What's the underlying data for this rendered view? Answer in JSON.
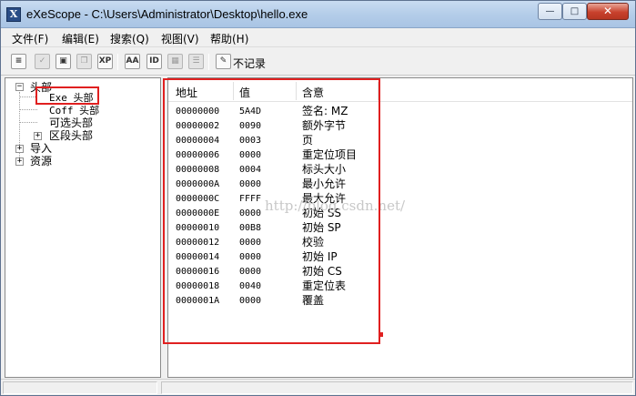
{
  "window": {
    "title": "eXeScope - C:\\Users\\Administrator\\Desktop\\hello.exe",
    "app_icon_text": "X",
    "buttons": {
      "minimize": "—",
      "maximize": "□",
      "close": "✕"
    }
  },
  "menu": [
    "文件(F)",
    "编辑(E)",
    "搜索(Q)",
    "视图(V)",
    "帮助(H)"
  ],
  "toolbar": {
    "icons": [
      {
        "name": "new-file-icon",
        "glyph": "≡",
        "disabled": false
      },
      {
        "name": "check-icon",
        "glyph": "✓",
        "disabled": true
      },
      {
        "name": "save-icon",
        "glyph": "▣",
        "disabled": false
      },
      {
        "name": "copy-icon",
        "glyph": "❐",
        "disabled": true
      },
      {
        "name": "xp-icon",
        "glyph": "XP",
        "disabled": false
      },
      {
        "name": "font-icon",
        "glyph": "AA",
        "disabled": false
      },
      {
        "name": "dialog-icon",
        "glyph": "ID",
        "disabled": false
      },
      {
        "name": "image-icon",
        "glyph": "▦",
        "disabled": true
      },
      {
        "name": "menu-icon",
        "glyph": "☰",
        "disabled": true
      },
      {
        "name": "record-icon",
        "glyph": "✎",
        "disabled": false
      }
    ],
    "record_label": "不记录"
  },
  "tree": {
    "root": "头部",
    "children": [
      "Exe 头部",
      "Coff 头部",
      "可选头部",
      "区段头部"
    ],
    "siblings": [
      "导入",
      "资源"
    ],
    "expander_open": "−",
    "expander_closed": "+"
  },
  "list": {
    "columns": [
      "地址",
      "值",
      "含意"
    ],
    "rows": [
      {
        "addr": "00000000",
        "val": "5A4D",
        "meaning": "签名: MZ"
      },
      {
        "addr": "00000002",
        "val": "0090",
        "meaning": "额外字节"
      },
      {
        "addr": "00000004",
        "val": "0003",
        "meaning": "页"
      },
      {
        "addr": "00000006",
        "val": "0000",
        "meaning": "重定位项目"
      },
      {
        "addr": "00000008",
        "val": "0004",
        "meaning": "标头大小"
      },
      {
        "addr": "0000000A",
        "val": "0000",
        "meaning": "最小允许"
      },
      {
        "addr": "0000000C",
        "val": "FFFF",
        "meaning": "最大允许"
      },
      {
        "addr": "0000000E",
        "val": "0000",
        "meaning": "初始 SS"
      },
      {
        "addr": "00000010",
        "val": "00B8",
        "meaning": "初始 SP"
      },
      {
        "addr": "00000012",
        "val": "0000",
        "meaning": "校验"
      },
      {
        "addr": "00000014",
        "val": "0000",
        "meaning": "初始 IP"
      },
      {
        "addr": "00000016",
        "val": "0000",
        "meaning": "初始 CS"
      },
      {
        "addr": "00000018",
        "val": "0040",
        "meaning": "重定位表"
      },
      {
        "addr": "0000001A",
        "val": "0000",
        "meaning": "覆盖"
      }
    ]
  },
  "watermark": "http://blog.csdn.net/",
  "colors": {
    "annotation": "#e02020",
    "titlebar": "#b4cde9"
  }
}
